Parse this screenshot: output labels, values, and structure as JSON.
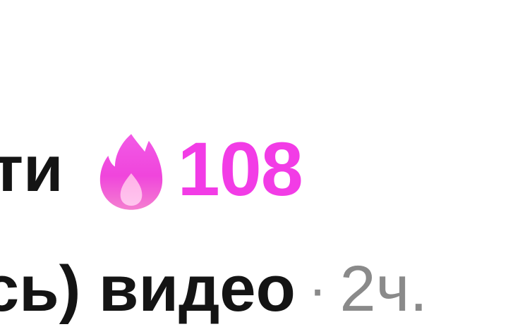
{
  "header": {
    "name_fragment": "ти",
    "streak": {
      "icon": "fire-icon",
      "count": "108",
      "color": "#f23ce6"
    }
  },
  "subtitle": {
    "text": "сь) видео",
    "separator": "·",
    "timestamp": "2ч."
  }
}
